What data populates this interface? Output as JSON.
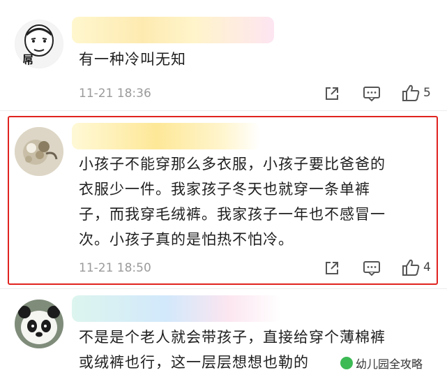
{
  "comments": [
    {
      "text": "有一种冷叫无知",
      "time": "11-21 18:36",
      "likes": "5"
    },
    {
      "text": "小孩子不能穿那么多衣服，小孩子要比爸爸的\n衣服少一件。我家孩子冬天也就穿一条单裤\n子，而我穿毛绒裤。我家孩子一年也不感冒一\n次。小孩子真的是怕热不怕冷。",
      "time": "11-21 18:50",
      "likes": "4",
      "highlighted": true
    },
    {
      "text": "不是是个老人就会带孩子，直接给穿个薄棉裤\n或绒裤也行，这一层层想想也勒的"
    }
  ],
  "avatar_text": "屌",
  "watermark": "幼儿园全攻略",
  "colors": {
    "highlight_border": "#e0231f",
    "meta_text": "#9a9a9a",
    "body_text": "#1e1e1e"
  },
  "icons": [
    "share-icon",
    "comment-icon",
    "like-icon"
  ]
}
